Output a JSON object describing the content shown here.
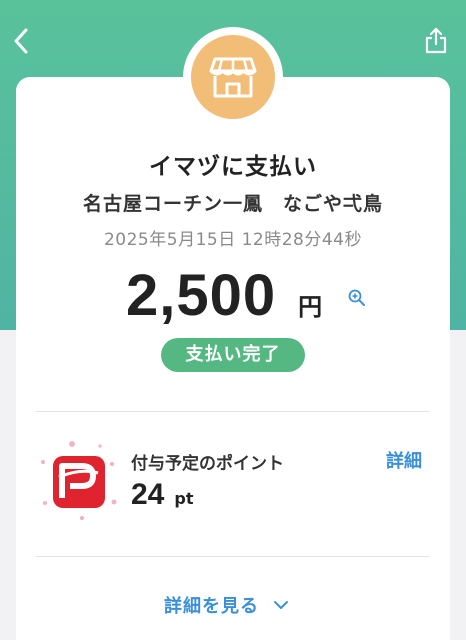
{
  "colors": {
    "header_green": "#59c29b",
    "accent_blue": "#3b8fd9",
    "status_green": "#55b882",
    "shop_orange": "#f2bd76",
    "paypay_red": "#e0242f"
  },
  "nav": {
    "back_icon": "chevron-left-icon",
    "share_icon": "share-icon"
  },
  "merchant": {
    "icon": "shop-icon",
    "title": "イマヅに支払い",
    "name": "名古屋コーチン一鳳　なごや弌鳥"
  },
  "payment": {
    "datetime": "2025年5月15日 12時28分44秒",
    "amount": "2,500",
    "currency": "円",
    "zoom_icon": "zoom-in-icon",
    "status": "支払い完了"
  },
  "points": {
    "logo": "paypay-logo",
    "label": "付与予定のポイント",
    "value": "24",
    "unit": "pt",
    "detail_link": "詳細"
  },
  "footer": {
    "see_details": "詳細を見る",
    "chevron_icon": "chevron-down-icon"
  }
}
